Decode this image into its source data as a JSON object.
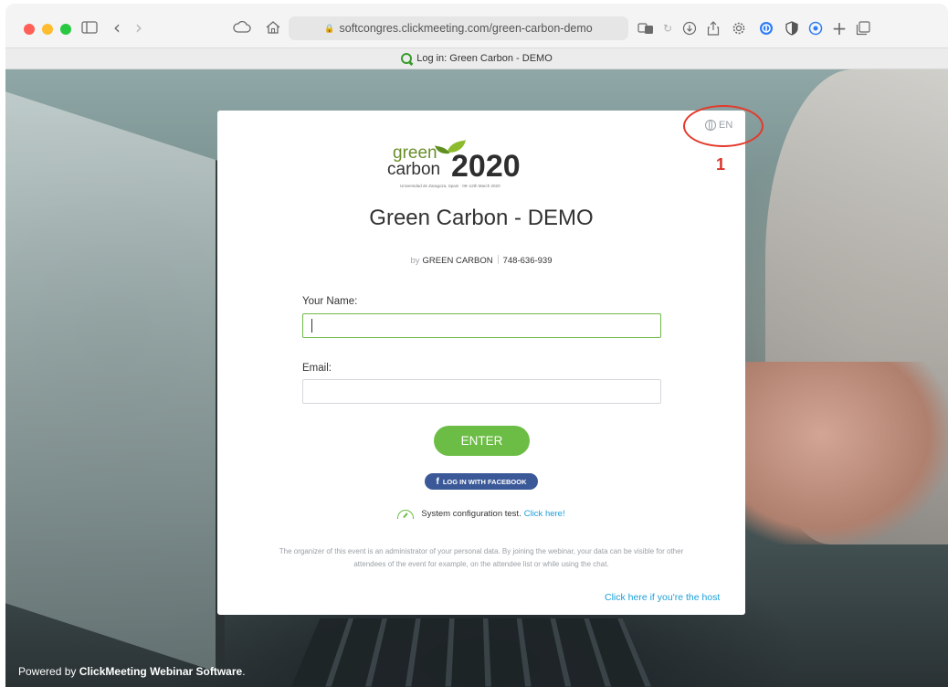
{
  "browser": {
    "address_url": "softcongres.clickmeeting.com/green-carbon-demo",
    "tab_title": "Log in: Green Carbon - DEMO"
  },
  "login": {
    "language": "EN",
    "annotation_number": "1",
    "logo": {
      "line1": "green",
      "line2": "carbon",
      "year": "2020",
      "tagline": "Universidad de Zaragoza, Spain · 09–12th March 2020"
    },
    "event_title": "Green Carbon - DEMO",
    "by_label": "by",
    "organizer": "GREEN CARBON",
    "event_id": "748-636-939",
    "name_label": "Your Name:",
    "name_value": "",
    "email_label": "Email:",
    "email_value": "",
    "enter_label": "ENTER",
    "facebook_label": "LOG IN WITH FACEBOOK",
    "system_test_text": "System configuration test.",
    "system_test_link": "Click here!",
    "privacy_text": "The organizer of this event is an administrator of your personal data. By joining the webinar, your data can be visible for other attendees of the event for example, on the attendee list or while using the chat.",
    "host_link": "Click here if you're the host"
  },
  "footer": {
    "powered_prefix": "Powered by",
    "powered_brand": "ClickMeeting Webinar Software",
    "powered_suffix": "."
  },
  "colors": {
    "accent_green": "#6cbd45",
    "facebook_blue": "#3b5998",
    "link_blue": "#1a9fd9",
    "annotation_red": "#e4392a"
  }
}
